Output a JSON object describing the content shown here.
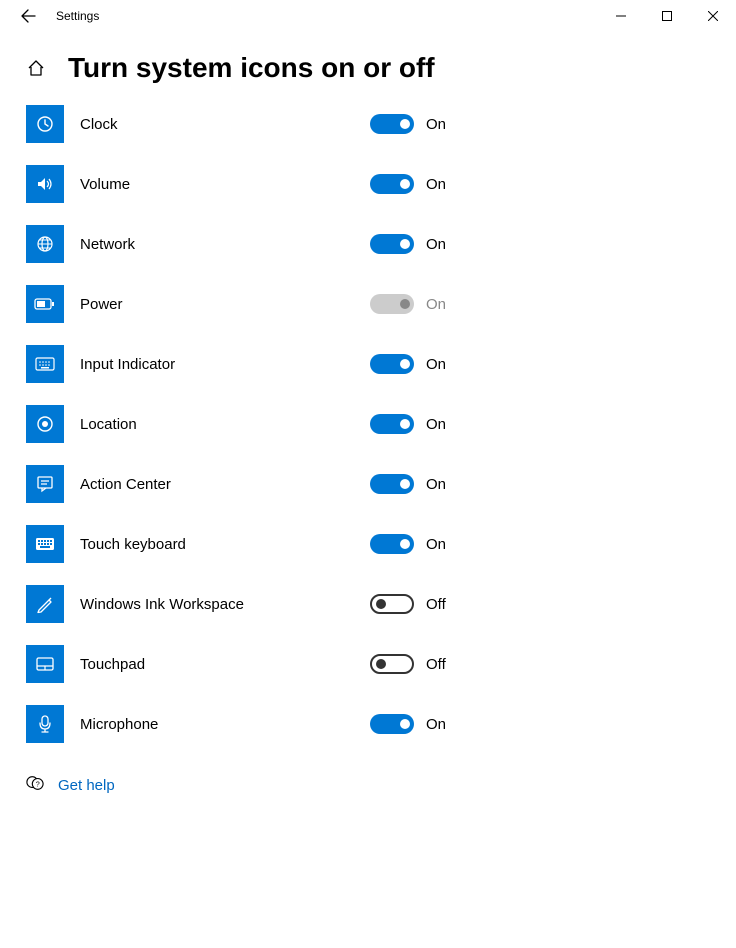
{
  "titlebar": {
    "title": "Settings"
  },
  "header": {
    "page_title": "Turn system icons on or off"
  },
  "state_labels": {
    "on": "On",
    "off": "Off"
  },
  "items": [
    {
      "icon": "clock",
      "label": "Clock",
      "state": "on"
    },
    {
      "icon": "volume",
      "label": "Volume",
      "state": "on"
    },
    {
      "icon": "network",
      "label": "Network",
      "state": "on"
    },
    {
      "icon": "power",
      "label": "Power",
      "state": "on",
      "disabled": true
    },
    {
      "icon": "input",
      "label": "Input Indicator",
      "state": "on"
    },
    {
      "icon": "location",
      "label": "Location",
      "state": "on"
    },
    {
      "icon": "action",
      "label": "Action Center",
      "state": "on"
    },
    {
      "icon": "touchkb",
      "label": "Touch keyboard",
      "state": "on"
    },
    {
      "icon": "ink",
      "label": "Windows Ink Workspace",
      "state": "off"
    },
    {
      "icon": "touchpad",
      "label": "Touchpad",
      "state": "off"
    },
    {
      "icon": "mic",
      "label": "Microphone",
      "state": "on"
    }
  ],
  "help": {
    "label": "Get help"
  }
}
